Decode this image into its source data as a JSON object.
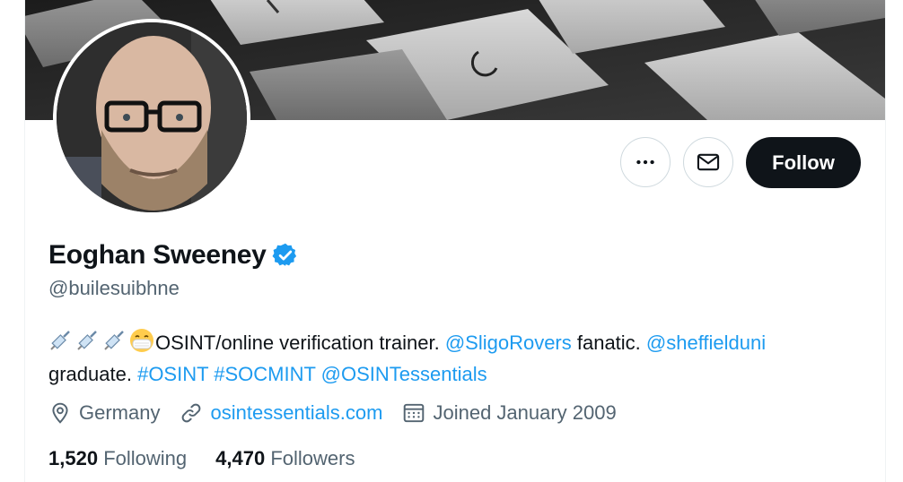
{
  "profile": {
    "name": "Eoghan Sweeney",
    "handle": "@builesuibhne",
    "verified": true
  },
  "actions": {
    "more_icon": "more-dots-icon",
    "message_icon": "envelope-icon",
    "follow_label": "Follow"
  },
  "bio": {
    "emoji": [
      "syringe",
      "syringe",
      "syringe",
      "face-with-medical-mask"
    ],
    "text1": "OSINT/online verification trainer. ",
    "mention1": "@SligoRovers",
    "text2": " fanatic. ",
    "mention2": "@sheffielduni",
    "text3": "graduate. ",
    "hashtag1": "#OSINT",
    "hashtag2": "#SOCMINT",
    "mention3": "@OSINTessentials"
  },
  "meta": {
    "location": "Germany",
    "website": "osintessentials.com",
    "joined": "Joined January 2009"
  },
  "stats": {
    "following_count": "1,520",
    "following_label": "Following",
    "followers_count": "4,470",
    "followers_label": "Followers"
  },
  "colors": {
    "link": "#1d9bf0",
    "secondary_text": "#536471",
    "primary_text": "#0f1419",
    "follow_bg": "#0f1419"
  }
}
